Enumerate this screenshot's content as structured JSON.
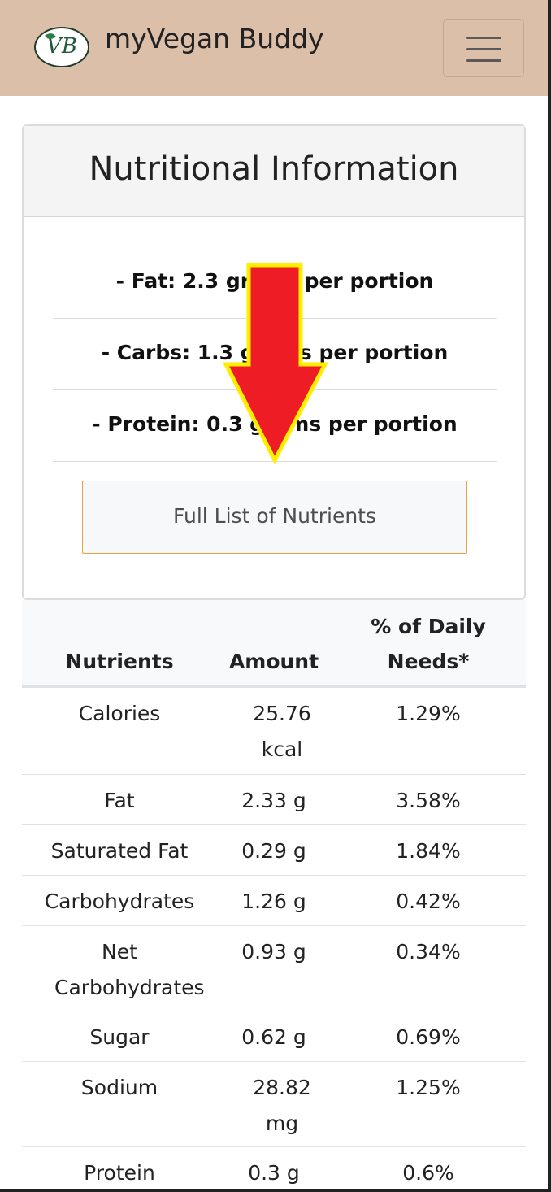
{
  "navbar": {
    "logo_text": "VB",
    "brand": "myVegan Buddy"
  },
  "card": {
    "title": "Nutritional Information",
    "macros": [
      "- Fat: 2.3 grams per portion",
      "- Carbs: 1.3 grams per portion",
      "- Protein: 0.3 grams per portion"
    ],
    "button_label": "Full List of Nutrients"
  },
  "table": {
    "headers": [
      "Nutrients",
      "Amount",
      "% of Daily Needs*"
    ],
    "rows": [
      {
        "nutrient": "Calories",
        "amount": "25.76 kcal",
        "daily": "1.29%"
      },
      {
        "nutrient": "Fat",
        "amount": "2.33 g",
        "daily": "3.58%"
      },
      {
        "nutrient": "Saturated Fat",
        "amount": "0.29 g",
        "daily": "1.84%"
      },
      {
        "nutrient": "Carbohydrates",
        "amount": "1.26 g",
        "daily": "0.42%"
      },
      {
        "nutrient": "Net Carbohydrates",
        "amount": "0.93 g",
        "daily": "0.34%"
      },
      {
        "nutrient": "Sugar",
        "amount": "0.62 g",
        "daily": "0.69%"
      },
      {
        "nutrient": "Sodium",
        "amount": "28.82 mg",
        "daily": "1.25%"
      },
      {
        "nutrient": "Protein",
        "amount": "0.3 g",
        "daily": "0.6%"
      }
    ]
  },
  "colors": {
    "navbar_bg": "#dcbfa9",
    "button_border": "#eda23f",
    "arrow_fill": "#ee1c24",
    "arrow_outline": "#ffee00"
  },
  "icons": {
    "menu": "hamburger-menu-icon",
    "annotation": "red-down-arrow-icon"
  }
}
